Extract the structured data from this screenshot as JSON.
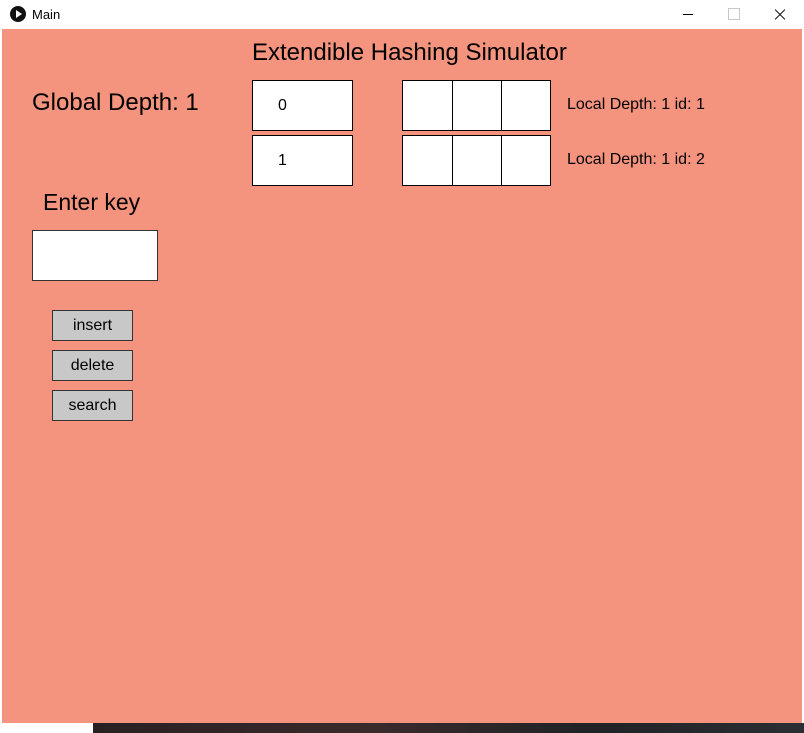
{
  "window": {
    "title": "Main",
    "icon": "play-circle-icon"
  },
  "app": {
    "heading": "Extendible Hashing Simulator",
    "global_depth_label": "Global Depth: 1",
    "enter_key_label": "Enter key",
    "key_input_value": "",
    "buttons": {
      "insert": "insert",
      "delete": "delete",
      "search": "search"
    },
    "directory": [
      {
        "index": "0"
      },
      {
        "index": "1"
      }
    ],
    "buckets": [
      {
        "label": "Local Depth: 1 id: 1",
        "slots": [
          "",
          "",
          ""
        ]
      },
      {
        "label": "Local Depth: 1 id: 2",
        "slots": [
          "",
          "",
          ""
        ]
      }
    ]
  },
  "colors": {
    "background": "#f4937e",
    "button": "#c8c8c8"
  }
}
